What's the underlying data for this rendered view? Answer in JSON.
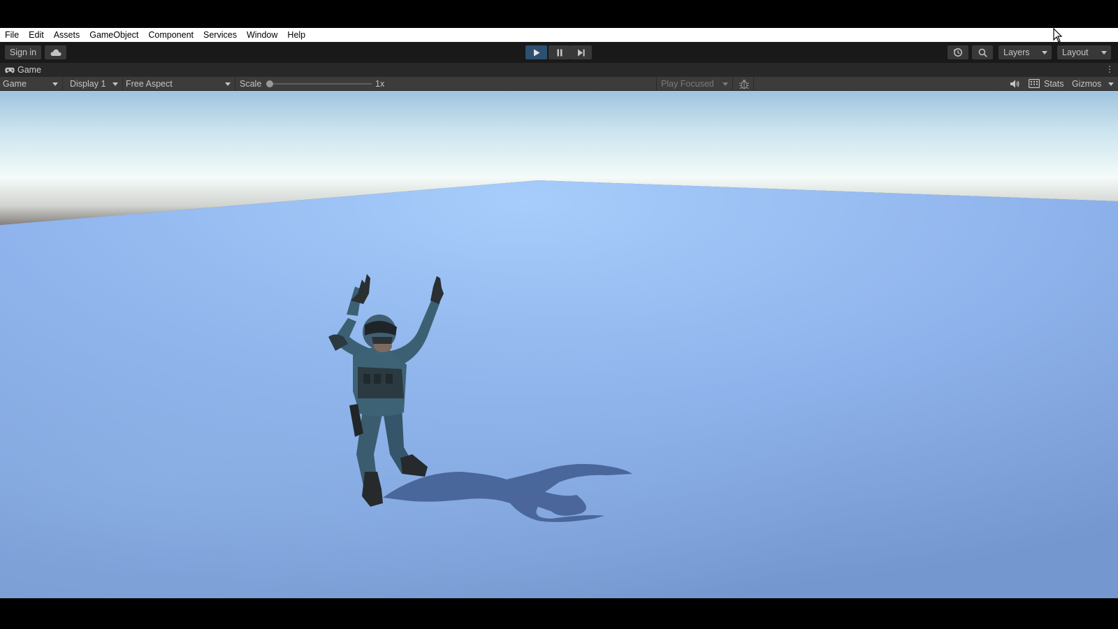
{
  "menu": {
    "items": [
      "File",
      "Edit",
      "Assets",
      "GameObject",
      "Component",
      "Services",
      "Window",
      "Help"
    ]
  },
  "toolbar": {
    "sign_in_label": "Sign in",
    "cloud_icon": "cloud-icon",
    "play_icon": "play-icon",
    "pause_icon": "pause-icon",
    "step_icon": "step-icon",
    "history_icon": "history-icon",
    "search_icon": "search-icon",
    "layers_label": "Layers",
    "layout_label": "Layout",
    "play_active_color": "#2d4f72"
  },
  "game_tab": {
    "label": "Game",
    "icon": "gamepad-icon",
    "menu_icon": "⋮"
  },
  "game_bar": {
    "view_select": "Game",
    "display_select": "Display 1",
    "aspect_select": "Free Aspect",
    "scale_label": "Scale",
    "scale_value": "1x",
    "play_mode_select": "Play Focused",
    "debug_icon": "bug-icon",
    "mute_icon": "speaker-icon",
    "keyboard_icon": "keyboard-icon",
    "stats_label": "Stats",
    "gizmos_label": "Gizmos"
  },
  "scene": {
    "sky_color": "#e9f5f8",
    "horizon_color": "#6e6665",
    "ground_color": "#86a8de",
    "character": "soldier with raised arms"
  }
}
